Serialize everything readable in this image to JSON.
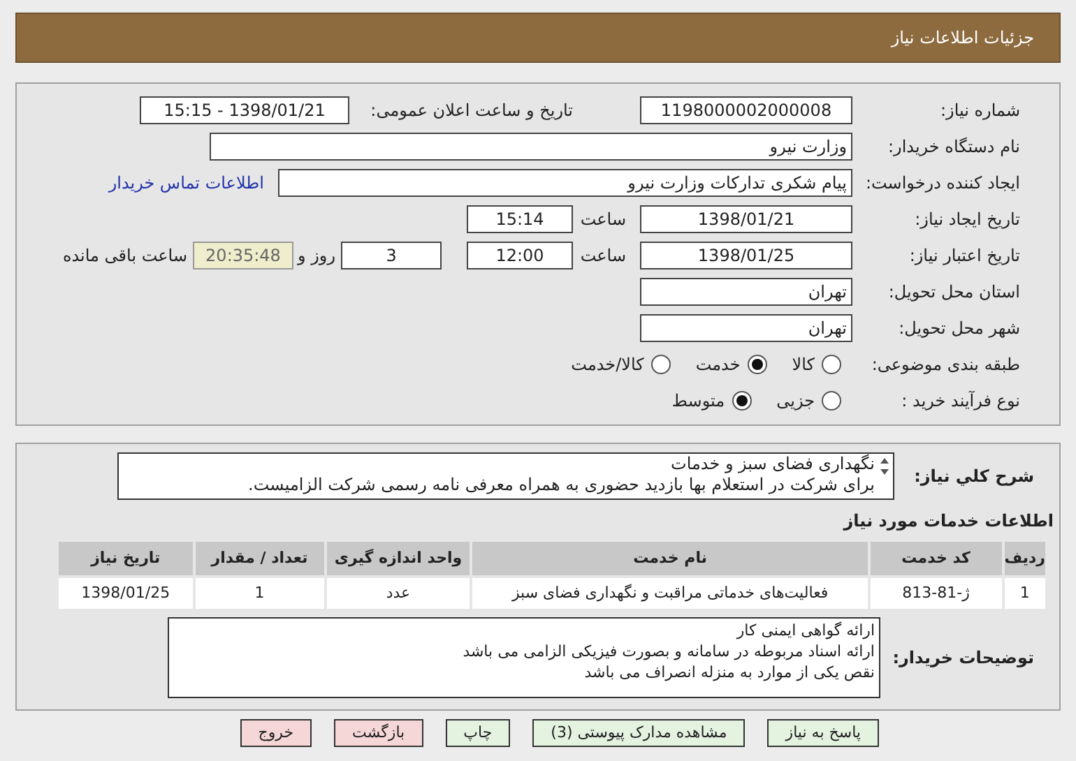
{
  "header": {
    "title": "جزئیات اطلاعات نیاز"
  },
  "details": {
    "need_number": {
      "label": "شماره نیاز:",
      "value": "1198000002000008"
    },
    "announce": {
      "label": "تاریخ و ساعت اعلان عمومی:",
      "value": "1398/01/21 - 15:15"
    },
    "buyer": {
      "label": "نام دستگاه خریدار:",
      "value": "وزارت نیرو"
    },
    "requester": {
      "label": "ایجاد کننده درخواست:",
      "value": "پیام شکری تدارکات وزارت نیرو",
      "link": "اطلاعات تماس خریدار"
    },
    "created": {
      "label": "تاریخ ایجاد نیاز:",
      "date": "1398/01/21",
      "time_label": "ساعت",
      "time": "15:14"
    },
    "validity": {
      "label": "تاریخ اعتبار نیاز:",
      "date": "1398/01/25",
      "time_label": "ساعت",
      "time": "12:00",
      "days": "3",
      "days_label": "روز و",
      "remaining": "20:35:48",
      "remaining_label": "ساعت باقی مانده"
    },
    "province": {
      "label": "استان محل تحویل:",
      "value": "تهران"
    },
    "city": {
      "label": "شهر محل تحویل:",
      "value": "تهران"
    },
    "category": {
      "label": "طبقه بندی موضوعی:",
      "options": [
        {
          "label": "کالا",
          "selected": false
        },
        {
          "label": "خدمت",
          "selected": true
        },
        {
          "label": "کالا/خدمت",
          "selected": false
        }
      ]
    },
    "process": {
      "label": "نوع فرآیند خرید :",
      "options": [
        {
          "label": "جزیی",
          "selected": false
        },
        {
          "label": "متوسط",
          "selected": true
        }
      ]
    }
  },
  "summary": {
    "label": "شرح کلي نياز:",
    "lines": [
      "نگهداری فضای سبز و خدمات",
      "برای شرکت در استعلام بها بازدید حضوری به همراه معرفی نامه رسمی شرکت الزامیست."
    ]
  },
  "services": {
    "title": "اطلاعات خدمات مورد نیاز",
    "columns": [
      "ردیف",
      "کد خدمت",
      "نام خدمت",
      "واحد اندازه گیری",
      "تعداد / مقدار",
      "تاریخ نیاز"
    ],
    "rows": [
      [
        "1",
        "ژ-81-813",
        "فعالیت‌های خدماتی مراقبت و نگهداری فضای سبز",
        "عدد",
        "1",
        "1398/01/25"
      ]
    ]
  },
  "buyer_notes": {
    "label": "توضیحات خریدار:",
    "lines": [
      "ارائه گواهی ایمنی کار",
      "ارائه اسناد مربوطه در سامانه و بصورت فیزیکی الزامی می باشد",
      "نقص یکی از موارد به منزله انصراف می باشد"
    ]
  },
  "buttons": [
    {
      "label": "پاسخ به نیاز",
      "kind": "action"
    },
    {
      "label": "مشاهده مدارک پیوستی (3)",
      "kind": "action"
    },
    {
      "label": "چاپ",
      "kind": "action"
    },
    {
      "label": "بازگشت",
      "kind": "exit"
    },
    {
      "label": "خروج",
      "kind": "exit"
    }
  ]
}
